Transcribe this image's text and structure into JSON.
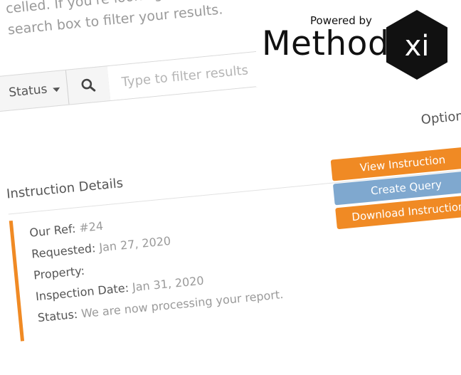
{
  "intro": {
    "line1": "celled. If you're looking for a specific ins",
    "line2": "search box to filter your results."
  },
  "toolbar": {
    "status_label": "Status",
    "search_icon": "search-icon",
    "filter_placeholder": "Type to filter results",
    "refresh_icon": "refresh-icon"
  },
  "list": {
    "details_heading": "Instruction Details",
    "options_heading": "Option"
  },
  "instruction": {
    "ref_label": "Our Ref:",
    "ref_value": "#24",
    "requested_label": "Requested:",
    "requested_value": "Jan 27, 2020",
    "property_label": "Property:",
    "property_value": "",
    "inspection_label": "Inspection Date:",
    "inspection_value": "Jan 31, 2020",
    "status_label": "Status:",
    "status_value": "We are now processing your report."
  },
  "options": {
    "view": "View Instruction",
    "query": "Create Query",
    "download": "Download Instruction"
  },
  "branding": {
    "powered_by": "Powered by",
    "method": "Method",
    "xi": "xi"
  },
  "colors": {
    "accent_orange": "#f08a24",
    "query_blue": "#7fa8cf",
    "logo_black": "#111111"
  }
}
